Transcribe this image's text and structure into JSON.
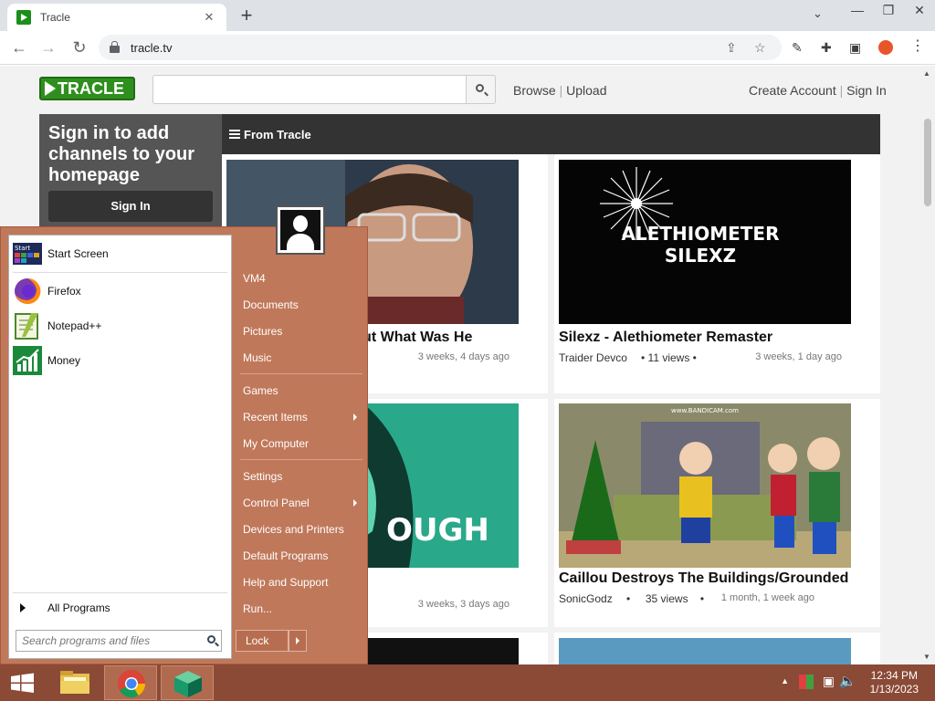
{
  "browser": {
    "tab_title": "Tracle",
    "url": "tracle.tv"
  },
  "site": {
    "logo": "TRACLE",
    "search_placeholder": "",
    "nav": [
      "Browse",
      "Upload"
    ],
    "account": [
      "Create Account",
      "Sign In"
    ],
    "signin_panel": {
      "message": "Sign in to add channels to your homepage",
      "button": "Sign In"
    },
    "section_title": "From Tracle",
    "videos": [
      {
        "title": "We Finally Found Out What Was He",
        "channel": "",
        "views": "",
        "ago": "3 weeks, 4 days ago"
      },
      {
        "title": "Silexz - Alethiometer Remaster",
        "channel": "Traider Devco",
        "views": "11 views",
        "ago": "3 weeks, 1 day ago",
        "thumb_text": "ALETHIOMETER SILEXZ"
      },
      {
        "title": "",
        "channel": "",
        "views": "",
        "ago": "3 weeks, 3 days ago",
        "thumb_text": "OUGH"
      },
      {
        "title": "Caillou Destroys The Buildings/Grounded",
        "channel": "SonicGodz",
        "views": "35 views",
        "ago": "1 month, 1 week ago",
        "thumb_text": "www.BANDICAM.com"
      }
    ]
  },
  "start_menu": {
    "pinned": [
      {
        "label": "Start Screen",
        "icon": "start-screen-icon"
      },
      {
        "label": "Firefox",
        "icon": "firefox-icon"
      },
      {
        "label": "Notepad++",
        "icon": "notepadpp-icon"
      },
      {
        "label": "Money",
        "icon": "money-icon"
      }
    ],
    "start_icon_text": "Start",
    "all_programs": "All Programs",
    "search_placeholder": "Search programs and files",
    "right": [
      "VM4",
      "Documents",
      "Pictures",
      "Music",
      "Games",
      "Recent Items",
      "My Computer",
      "Settings",
      "Control Panel",
      "Devices and Printers",
      "Default Programs",
      "Help and Support",
      "Run..."
    ],
    "lock": "Lock"
  },
  "taskbar": {
    "time": "12:34 PM",
    "date": "1/13/2023"
  },
  "colors": {
    "start_menu": "#c0785a",
    "taskbar": "#8a4a36",
    "brand": "#2f8f1e"
  }
}
